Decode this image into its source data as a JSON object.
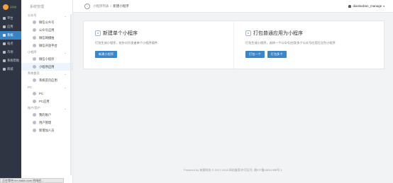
{
  "app": {
    "logo_text": "来客推",
    "colors": {
      "accent": "#3a86c8",
      "rail_bg": "#2f3542"
    }
  },
  "rail": {
    "items": [
      {
        "label": "平台",
        "icon": "home-icon"
      },
      {
        "label": "应用",
        "icon": "grid-icon"
      },
      {
        "label": "系统",
        "icon": "gear-icon",
        "active": true
      },
      {
        "label": "站点",
        "icon": "site-icon"
      },
      {
        "label": "市场",
        "icon": "market-icon"
      },
      {
        "label": "系统帮助",
        "icon": "help-icon"
      },
      {
        "label": "商城",
        "icon": "shop-icon"
      }
    ]
  },
  "sidebar": {
    "title": "系统管理",
    "sections": [
      {
        "label": "公众号",
        "items": [
          {
            "label": "微信公众号"
          },
          {
            "label": "公众号应用"
          },
          {
            "label": "微信网播拍"
          },
          {
            "label": "微信开放平台"
          }
        ]
      },
      {
        "label": "小程序",
        "items": [
          {
            "label": "微信小程序"
          },
          {
            "label": "小程序应用",
            "active": true
          }
        ]
      },
      {
        "label": "系统首页",
        "items": [
          {
            "label": "系统首页应用"
          }
        ]
      },
      {
        "label": "PC",
        "items": [
          {
            "label": "PC"
          },
          {
            "label": "PC应用"
          }
        ]
      },
      {
        "label": "账户/用户",
        "items": [
          {
            "label": "我的账户"
          },
          {
            "label": "用户管理"
          },
          {
            "label": "新增加人员"
          }
        ]
      }
    ]
  },
  "header": {
    "breadcrumb": {
      "parent": "小程序列表",
      "separator": "/",
      "current": "新建小程序"
    },
    "username": "dianlaoban_manage"
  },
  "main": {
    "left": {
      "title": "新建单个小程序",
      "desc": "打包生成小程序，仅针对开发者单个小程序插件.",
      "button": "新建小程序"
    },
    "right": {
      "title": "打包普通应用为小程序",
      "desc": "打包生成小程序，选择一个公众号应用/多个公众号应用打包为小程序",
      "buttons": [
        "打包一个",
        "打包多个"
      ]
    }
  },
  "footer": {
    "text": "Powered by 来客科技 © 2017-2018 网站备案/许可证号: 湘ICP备18011498号-1"
  },
  "status": {
    "text": "正在等待 hm.baidu.com 的响应..."
  }
}
